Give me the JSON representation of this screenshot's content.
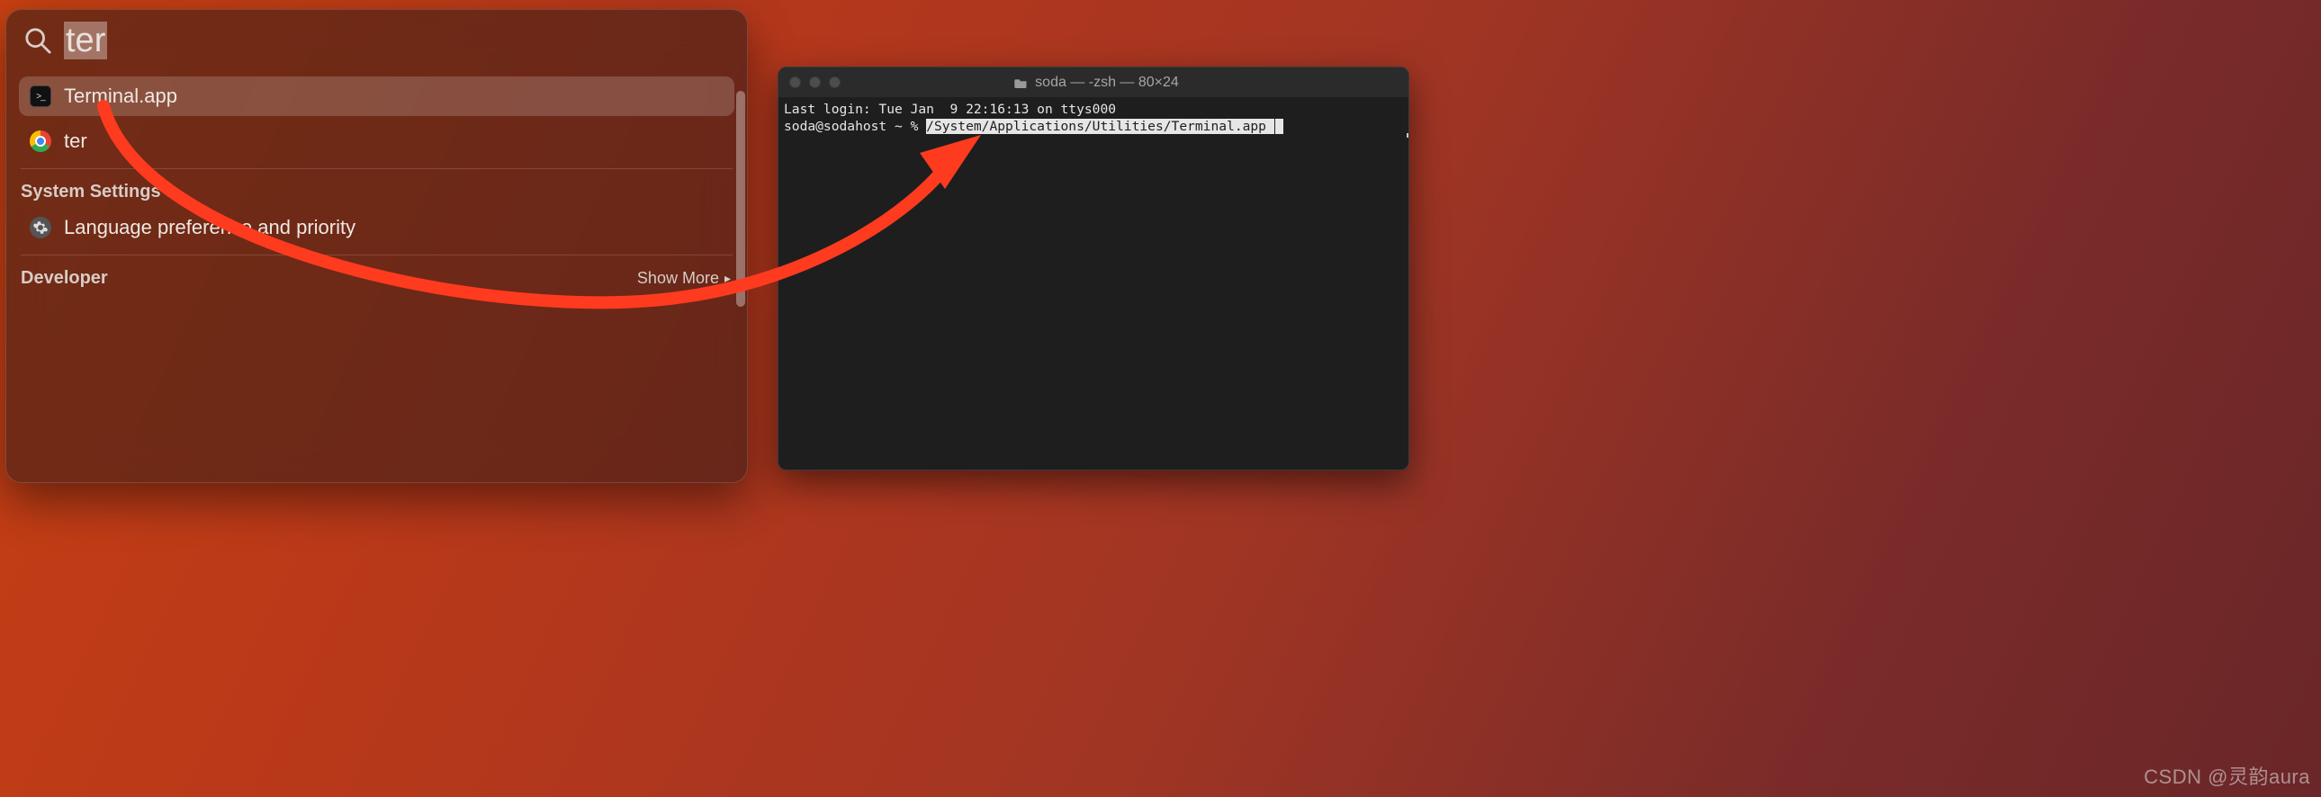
{
  "spotlight": {
    "search_query": "ter",
    "results": {
      "top": [
        {
          "label": "Terminal.app",
          "icon": "terminal",
          "selected": true
        },
        {
          "label": "ter",
          "icon": "chrome",
          "selected": false
        }
      ],
      "sections": [
        {
          "title": "System Settings",
          "items": [
            {
              "label": "Language preference and priority",
              "icon": "gear"
            }
          ]
        },
        {
          "title": "Developer",
          "show_more_label": "Show More",
          "items": []
        }
      ]
    }
  },
  "terminal": {
    "title": "soda — -zsh — 80×24",
    "lines": {
      "last_login": "Last login: Tue Jan  9 22:16:13 on ttys000",
      "prompt": "soda@sodahost ~ % ",
      "highlighted_path": "/System/Applications/Utilities/Terminal.app "
    }
  },
  "watermark": "CSDN @灵韵aura"
}
